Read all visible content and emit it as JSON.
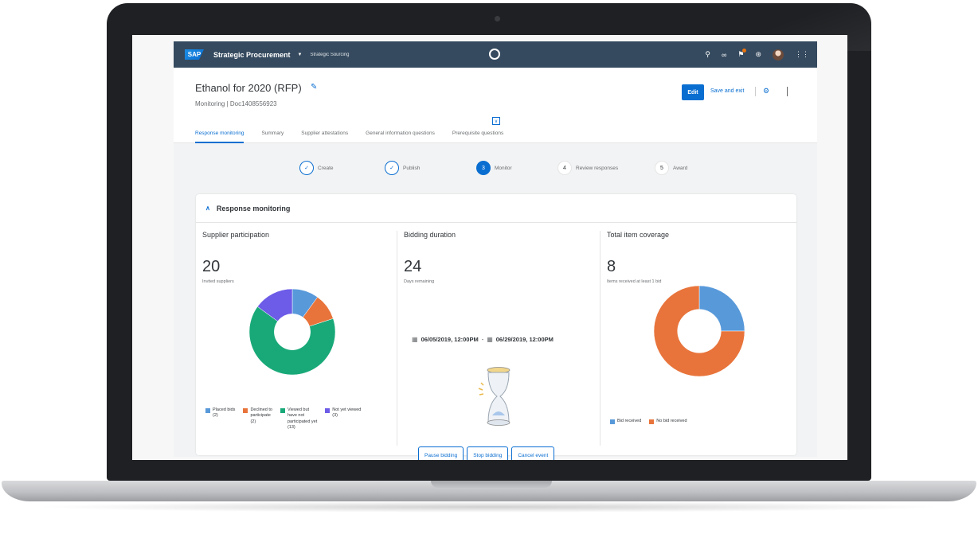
{
  "shell": {
    "logo": "SAP",
    "title": "Strategic Procurement",
    "caret": "▼",
    "subtitle": "Strategic Sourcing",
    "icons": [
      "search-icon",
      "link-icon",
      "notifications-icon",
      "help-icon",
      "avatar",
      "product-switch-icon"
    ]
  },
  "header": {
    "title": "Ethanol for 2020 (RFP)",
    "subtitle": "Monitoring | Doc1408556923",
    "edit_label": "Edit",
    "save_label": "Save and exit",
    "tabs": [
      {
        "label": "Response monitoring",
        "active": true
      },
      {
        "label": "Summary",
        "active": false
      },
      {
        "label": "Supplier attestations",
        "active": false
      },
      {
        "label": "General information questions",
        "active": false
      },
      {
        "label": "Prerequisite questions",
        "active": false
      }
    ]
  },
  "steps": [
    {
      "num": "✓",
      "label": "Create",
      "state": "done"
    },
    {
      "num": "✓",
      "label": "Publish",
      "state": "done"
    },
    {
      "num": "3",
      "label": "Monitor",
      "state": "current"
    },
    {
      "num": "4",
      "label": "Review responses",
      "state": "todo"
    },
    {
      "num": "5",
      "label": "Award",
      "state": "todo"
    }
  ],
  "panel": {
    "title": "Response monitoring",
    "supplier": {
      "title": "Supplier participation",
      "kpi": "20",
      "kpi_sub": "Invited suppliers",
      "legend": [
        {
          "label": "Placed bids\n(2)",
          "color": "#5899da"
        },
        {
          "label": "Declined to\nparticipate\n(2)",
          "color": "#e8743b"
        },
        {
          "label": "Viewed but\nhave not\nparticipated yet\n(13)",
          "color": "#19a979"
        },
        {
          "label": "Not yet viewed\n(3)",
          "color": "#6c5ce7"
        }
      ]
    },
    "bidding": {
      "title": "Bidding duration",
      "kpi": "24",
      "kpi_sub": "Days remaining",
      "start": "06/05/2019, 12:00PM",
      "sep": "-",
      "end": "06/29/2019, 12:00PM",
      "buttons": [
        "Pause bidding",
        "Stop bidding",
        "Cancel event"
      ]
    },
    "coverage": {
      "title": "Total item coverage",
      "kpi": "8",
      "kpi_sub": "Items received at least 1 bid",
      "legend": [
        {
          "label": "Bid received",
          "color": "#5899da"
        },
        {
          "label": "No bid received",
          "color": "#e8743b"
        }
      ]
    }
  },
  "chart_data": [
    {
      "type": "pie",
      "title": "Supplier participation",
      "categories": [
        "Placed bids",
        "Declined to participate",
        "Viewed but have not participated yet",
        "Not yet viewed"
      ],
      "values": [
        2,
        2,
        13,
        3
      ],
      "colors": [
        "#5899da",
        "#e8743b",
        "#19a979",
        "#6c5ce7"
      ]
    },
    {
      "type": "pie",
      "title": "Total item coverage",
      "categories": [
        "Bid received",
        "No bid received"
      ],
      "values": [
        2,
        6
      ],
      "colors": [
        "#5899da",
        "#e8743b"
      ]
    }
  ]
}
